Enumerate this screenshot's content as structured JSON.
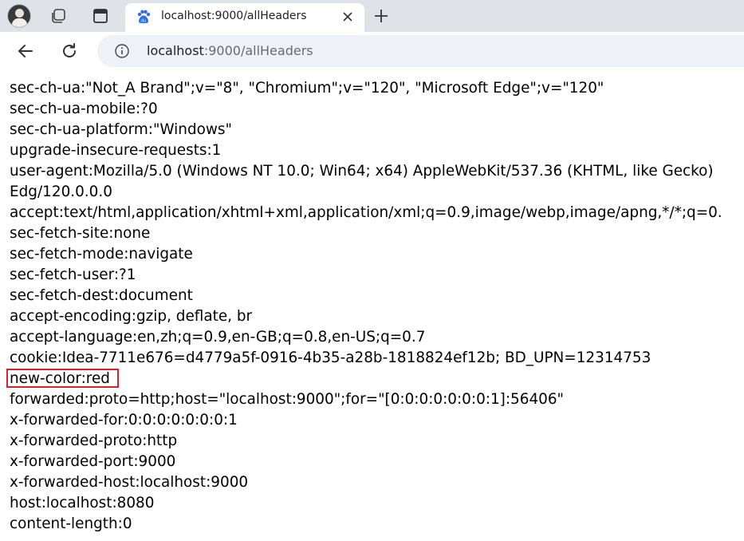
{
  "browser": {
    "tab": {
      "title": "localhost:9000/allHeaders",
      "favicon": "baidu-paw-icon"
    },
    "address_bar": {
      "host": "localhost",
      "path": ":9000/allHeaders"
    },
    "icons": {
      "profile": "profile-avatar",
      "workspaces": "workspaces-icon",
      "vertical_tabs": "vertical-tabs-icon",
      "close_tab": "close-icon",
      "new_tab": "plus-icon",
      "back": "back-arrow-icon",
      "reload": "reload-icon",
      "site_info": "info-icon"
    },
    "colors": {
      "accent": "#2b6ee6",
      "highlight_border": "#d9232d"
    }
  },
  "page": {
    "lines": [
      "sec-ch-ua:\"Not_A Brand\";v=\"8\", \"Chromium\";v=\"120\", \"Microsoft Edge\";v=\"120\"",
      "sec-ch-ua-mobile:?0",
      "sec-ch-ua-platform:\"Windows\"",
      "upgrade-insecure-requests:1",
      "user-agent:Mozilla/5.0 (Windows NT 10.0; Win64; x64) AppleWebKit/537.36 (KHTML, like Gecko)",
      "Edg/120.0.0.0",
      "accept:text/html,application/xhtml+xml,application/xml;q=0.9,image/webp,image/apng,*/*;q=0.",
      "sec-fetch-site:none",
      "sec-fetch-mode:navigate",
      "sec-fetch-user:?1",
      "sec-fetch-dest:document",
      "accept-encoding:gzip, deflate, br",
      "accept-language:en,zh;q=0.9,en-GB;q=0.8,en-US;q=0.7",
      "cookie:Idea-7711e676=d4779a5f-0916-4b35-a28b-1818824ef12b; BD_UPN=12314753",
      "new-color:red",
      "forwarded:proto=http;host=\"localhost:9000\";for=\"[0:0:0:0:0:0:0:1]:56406\"",
      "x-forwarded-for:0:0:0:0:0:0:0:1",
      "x-forwarded-proto:http",
      "x-forwarded-port:9000",
      "x-forwarded-host:localhost:9000",
      "host:localhost:8080",
      "content-length:0"
    ]
  }
}
